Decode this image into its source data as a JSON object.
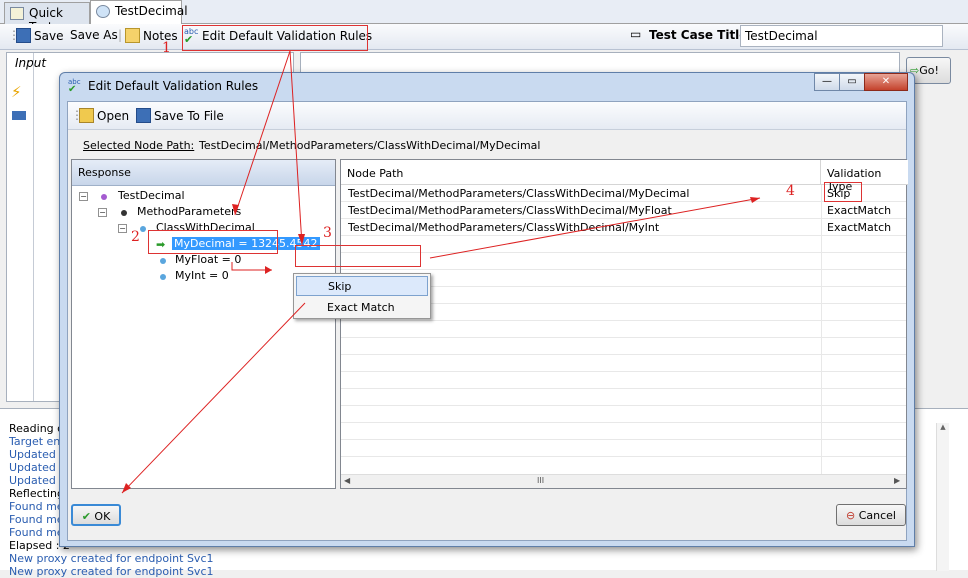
{
  "tabs": [
    {
      "label": "Quick Test",
      "active": false
    },
    {
      "label": "TestDecimal",
      "active": true
    }
  ],
  "toolbar": {
    "save": "Save",
    "save_as": "Save As",
    "notes": "Notes",
    "edit_rules": "Edit Default Validation Rules",
    "title_label": "Test Case Title :",
    "title_value": "TestDecimal",
    "go": "Go!"
  },
  "input_pane": {
    "header": "Input"
  },
  "log": [
    {
      "text": "Reading c",
      "color": "#000000"
    },
    {
      "text": "Target end",
      "color": "#2a5db0"
    },
    {
      "text": "Updated b",
      "color": "#2a5db0"
    },
    {
      "text": "Updated E",
      "color": "#2a5db0"
    },
    {
      "text": "Updated E",
      "color": "#2a5db0"
    },
    {
      "text": "Reflecting",
      "color": "#000000"
    },
    {
      "text": "Found met",
      "color": "#2a5db0"
    },
    {
      "text": "Found met",
      "color": "#2a5db0"
    },
    {
      "text": "Found met",
      "color": "#2a5db0"
    },
    {
      "text": "Elapsed : 2",
      "color": "#000000"
    },
    {
      "text": "New proxy created for endpoint Svc1",
      "color": "#2a5db0"
    },
    {
      "text": "New proxy created for endpoint Svc1",
      "color": "#2a5db0"
    }
  ],
  "dialog": {
    "title": "Edit Default Validation Rules",
    "open": "Open",
    "save_to_file": "Save To File",
    "node_path_label": "Selected Node Path:",
    "node_path_value": "TestDecimal/MethodParameters/ClassWithDecimal/MyDecimal",
    "tree_header": "Response",
    "tree": {
      "root": "TestDecimal",
      "params": "MethodParameters",
      "cls": "ClassWithDecimal",
      "my_decimal": "MyDecimal = 13245.4542",
      "my_float": "MyFloat = 0",
      "my_int": "MyInt = 0"
    },
    "grid": {
      "col_path": "Node Path",
      "col_type": "Validation Type",
      "rows": [
        {
          "path": "TestDecimal/MethodParameters/ClassWithDecimal/MyDecimal",
          "type": "Skip"
        },
        {
          "path": "TestDecimal/MethodParameters/ClassWithDecimal/MyFloat",
          "type": "ExactMatch"
        },
        {
          "path": "TestDecimal/MethodParameters/ClassWithDecimal/MyInt",
          "type": "ExactMatch"
        }
      ],
      "scroll_thumb": "III"
    },
    "context_menu": {
      "skip": "Skip",
      "exact": "Exact Match"
    },
    "ok": "OK",
    "cancel": "Cancel"
  },
  "annotations": {
    "n1": "1",
    "n2": "2",
    "n3": "3",
    "n4": "4",
    "color": "#dd2222"
  }
}
